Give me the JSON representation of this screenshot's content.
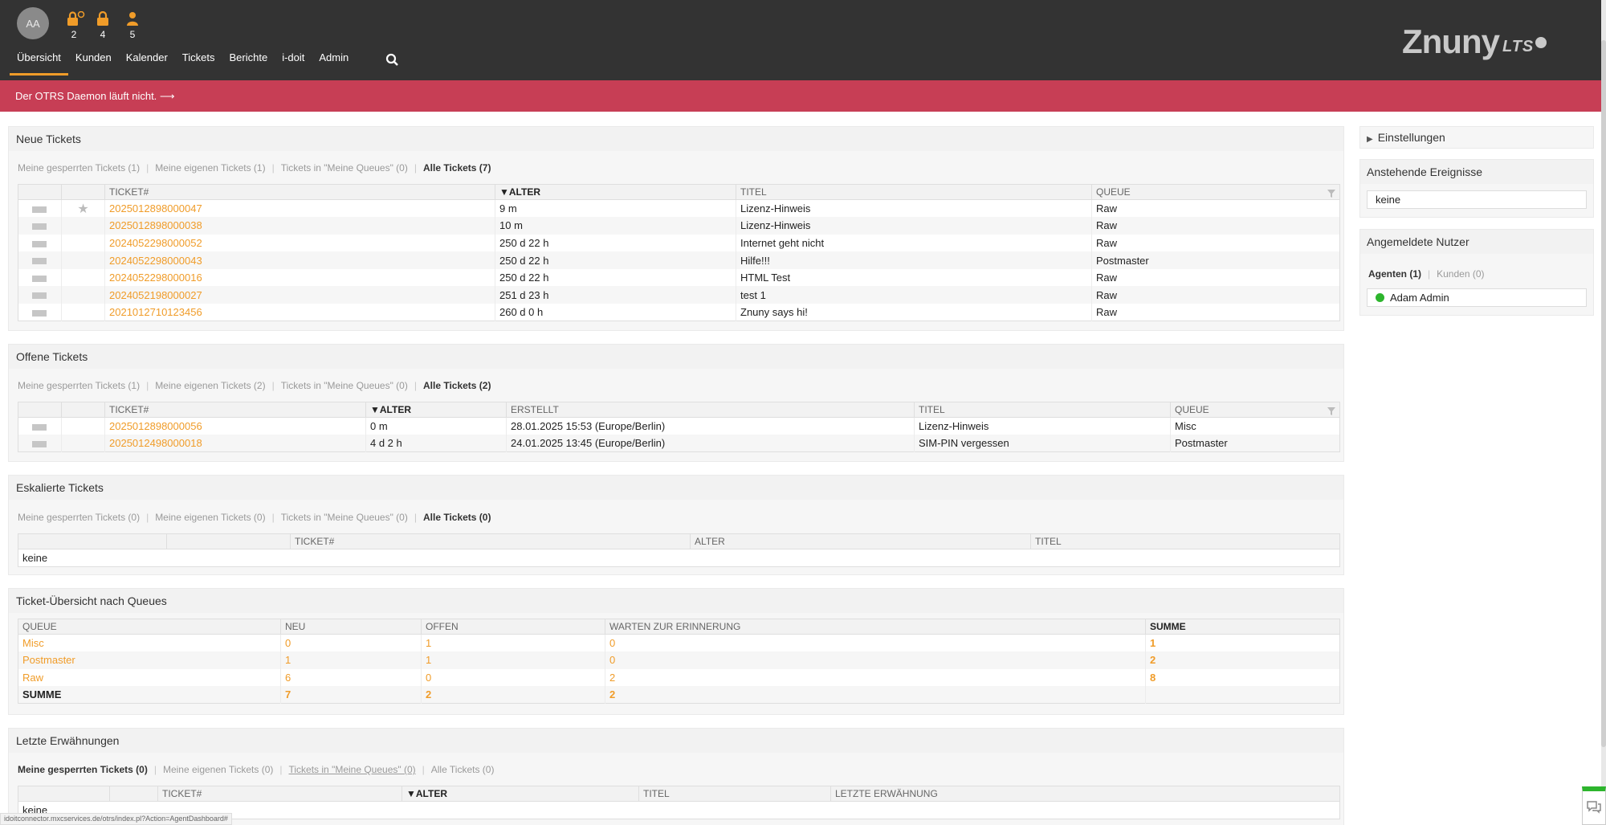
{
  "header": {
    "avatar": "AA",
    "toolbar": [
      {
        "icon": "locked-tickets-new-icon",
        "count": "2"
      },
      {
        "icon": "locked-tickets-icon",
        "count": "4"
      },
      {
        "icon": "responsible-tickets-icon",
        "count": "5"
      }
    ],
    "nav": [
      "Übersicht",
      "Kunden",
      "Kalender",
      "Tickets",
      "Berichte",
      "i-doit",
      "Admin"
    ],
    "logo": "Znuny",
    "logo_suffix": "LTS"
  },
  "alert": "Der OTRS Daemon läuft nicht. ⟶",
  "new_tickets": {
    "title": "Neue Tickets",
    "filters": [
      "Meine gesperrten Tickets (1)",
      "Meine eigenen Tickets (1)",
      "Tickets in \"Meine Queues\" (0)",
      "Alle Tickets (7)"
    ],
    "columns": [
      "TICKET#",
      "▼ALTER",
      "TITEL",
      "QUEUE"
    ],
    "rows": [
      {
        "ticket": "2025012898000047",
        "age": "9 m",
        "title": "Lizenz-Hinweis",
        "queue": "Raw"
      },
      {
        "ticket": "2025012898000038",
        "age": "10 m",
        "title": "Lizenz-Hinweis",
        "queue": "Raw"
      },
      {
        "ticket": "2024052298000052",
        "age": "250 d 22 h",
        "title": "Internet geht nicht",
        "queue": "Raw"
      },
      {
        "ticket": "2024052298000043",
        "age": "250 d 22 h",
        "title": "Hilfe!!!",
        "queue": "Postmaster"
      },
      {
        "ticket": "2024052298000016",
        "age": "250 d 22 h",
        "title": "HTML Test",
        "queue": "Raw"
      },
      {
        "ticket": "2024052198000027",
        "age": "251 d 23 h",
        "title": "test 1",
        "queue": "Raw"
      },
      {
        "ticket": "2021012710123456",
        "age": "260 d 0 h",
        "title": "Znuny says hi!",
        "queue": "Raw"
      }
    ]
  },
  "open_tickets": {
    "title": "Offene Tickets",
    "filters": [
      "Meine gesperrten Tickets (1)",
      "Meine eigenen Tickets (2)",
      "Tickets in \"Meine Queues\" (0)",
      "Alle Tickets (2)"
    ],
    "columns": [
      "TICKET#",
      "▼ALTER",
      "ERSTELLT",
      "TITEL",
      "QUEUE"
    ],
    "rows": [
      {
        "ticket": "2025012898000056",
        "age": "0 m",
        "created": "28.01.2025 15:53 (Europe/Berlin)",
        "title": "Lizenz-Hinweis",
        "queue": "Misc"
      },
      {
        "ticket": "2025012498000018",
        "age": "4 d 2 h",
        "created": "24.01.2025 13:45 (Europe/Berlin)",
        "title": "SIM-PIN vergessen",
        "queue": "Postmaster"
      }
    ]
  },
  "escalated_tickets": {
    "title": "Eskalierte Tickets",
    "filters": [
      "Meine gesperrten Tickets (0)",
      "Meine eigenen Tickets (0)",
      "Tickets in \"Meine Queues\" (0)",
      "Alle Tickets (0)"
    ],
    "columns": [
      "TICKET#",
      "ALTER",
      "TITEL"
    ],
    "empty": "keine"
  },
  "queue_overview": {
    "title": "Ticket-Übersicht nach Queues",
    "columns": [
      "QUEUE",
      "NEU",
      "OFFEN",
      "WARTEN ZUR ERINNERUNG",
      "SUMME"
    ],
    "rows": [
      {
        "queue": "Misc",
        "new": "0",
        "open": "1",
        "pending": "0",
        "sum": "1"
      },
      {
        "queue": "Postmaster",
        "new": "1",
        "open": "1",
        "pending": "0",
        "sum": "2"
      },
      {
        "queue": "Raw",
        "new": "6",
        "open": "0",
        "pending": "2",
        "sum": "8"
      }
    ],
    "total": {
      "label": "SUMME",
      "new": "7",
      "open": "2",
      "pending": "2"
    }
  },
  "mentions": {
    "title": "Letzte Erwähnungen",
    "filters": [
      "Meine gesperrten Tickets (0)",
      "Meine eigenen Tickets (0)",
      "Tickets in \"Meine Queues\" (0)",
      "Alle Tickets (0)"
    ],
    "columns": [
      "TICKET#",
      "▼ALTER",
      "TITEL",
      "LETZTE ERWÄHNUNG"
    ],
    "empty": "keine"
  },
  "sidebar": {
    "settings": "Einstellungen",
    "events_title": "Anstehende Ereignisse",
    "events_value": "keine",
    "users_title": "Angemeldete Nutzer",
    "users_filters": [
      "Agenten (1)",
      "Kunden (0)"
    ],
    "user_name": "Adam Admin"
  },
  "status_url": "idoitconnector.mxcservices.de/otrs/index.pl?Action=AgentDashboard#"
}
